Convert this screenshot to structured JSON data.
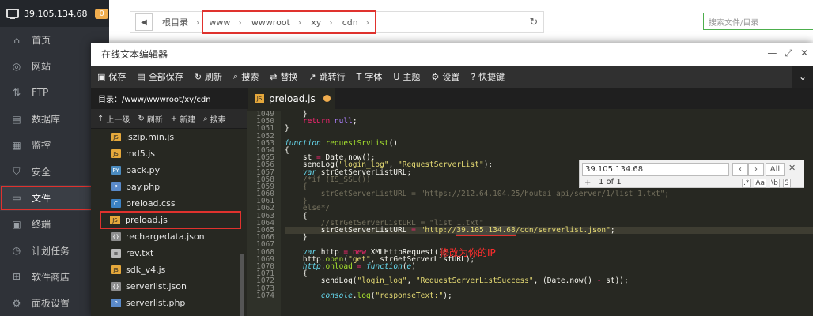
{
  "sidebar": {
    "server_ip": "39.105.134.68",
    "badge": "0",
    "items": [
      {
        "label": "首页",
        "icon": "home-icon"
      },
      {
        "label": "网站",
        "icon": "globe-icon"
      },
      {
        "label": "FTP",
        "icon": "ftp-icon"
      },
      {
        "label": "数据库",
        "icon": "database-icon"
      },
      {
        "label": "监控",
        "icon": "monitor-icon"
      },
      {
        "label": "安全",
        "icon": "shield-icon"
      },
      {
        "label": "文件",
        "icon": "folder-icon"
      },
      {
        "label": "终端",
        "icon": "terminal-icon"
      },
      {
        "label": "计划任务",
        "icon": "clock-icon"
      },
      {
        "label": "软件商店",
        "icon": "store-icon"
      },
      {
        "label": "面板设置",
        "icon": "gear-icon"
      }
    ]
  },
  "pathbar": {
    "root": "根目录",
    "segments": [
      "www",
      "wwwroot",
      "xy",
      "cdn"
    ]
  },
  "search": {
    "placeholder": "搜索文件/目录"
  },
  "editor": {
    "title": "在线文本编辑器",
    "toolbar": [
      "保存",
      "全部保存",
      "刷新",
      "搜索",
      "替换",
      "跳转行",
      "字体",
      "主题",
      "设置",
      "快捷键"
    ],
    "dir_label": "目录：/www/wwwroot/xy/cdn",
    "actions": [
      "上一级",
      "刷新",
      "新建",
      "搜索"
    ],
    "files": [
      {
        "name": "jszip.min.js",
        "type": "js"
      },
      {
        "name": "md5.js",
        "type": "js"
      },
      {
        "name": "pack.py",
        "type": "py"
      },
      {
        "name": "pay.php",
        "type": "php"
      },
      {
        "name": "preload.css",
        "type": "css"
      },
      {
        "name": "preload.js",
        "type": "js"
      },
      {
        "name": "rechargedata.json",
        "type": "json"
      },
      {
        "name": "rev.txt",
        "type": "txt"
      },
      {
        "name": "sdk_v4.js",
        "type": "js"
      },
      {
        "name": "serverlist.json",
        "type": "json"
      },
      {
        "name": "serverlist.php",
        "type": "php"
      }
    ],
    "tab": "preload.js"
  },
  "code": {
    "line_numbers": [
      "1049",
      "1050",
      "1051",
      "1052",
      "1053",
      "1054",
      "1055",
      "1056",
      "1057",
      "1058",
      "1059",
      "1060",
      "1061",
      "1062",
      "1063",
      "1064",
      "1065",
      "1066",
      "1067",
      "1068",
      "1069",
      "1070",
      "1071",
      "1072",
      "1073",
      "1074"
    ],
    "annotation": "修改为你的IP",
    "highlight_ip": "39.105.134.68"
  },
  "find": {
    "value": "39.105.134.68",
    "count": "1 of 1",
    "all": "All",
    "opts": [
      ".*",
      "Aa",
      "\\b",
      "S"
    ]
  }
}
